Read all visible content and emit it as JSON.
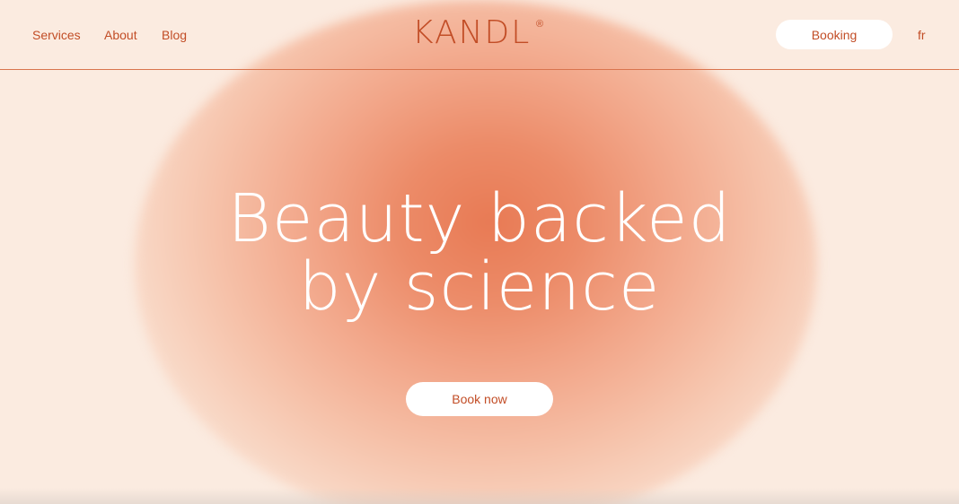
{
  "nav": {
    "services": "Services",
    "about": "About",
    "blog": "Blog"
  },
  "brand": {
    "name": "KANDL",
    "registered": "®"
  },
  "actions": {
    "booking": "Booking",
    "language": "fr"
  },
  "hero": {
    "line1": "Beauty backed",
    "line2": "by science",
    "cta": "Book now"
  },
  "colors": {
    "background": "#fbebe0",
    "accent": "#c24d26",
    "glow": "#e87a54"
  }
}
